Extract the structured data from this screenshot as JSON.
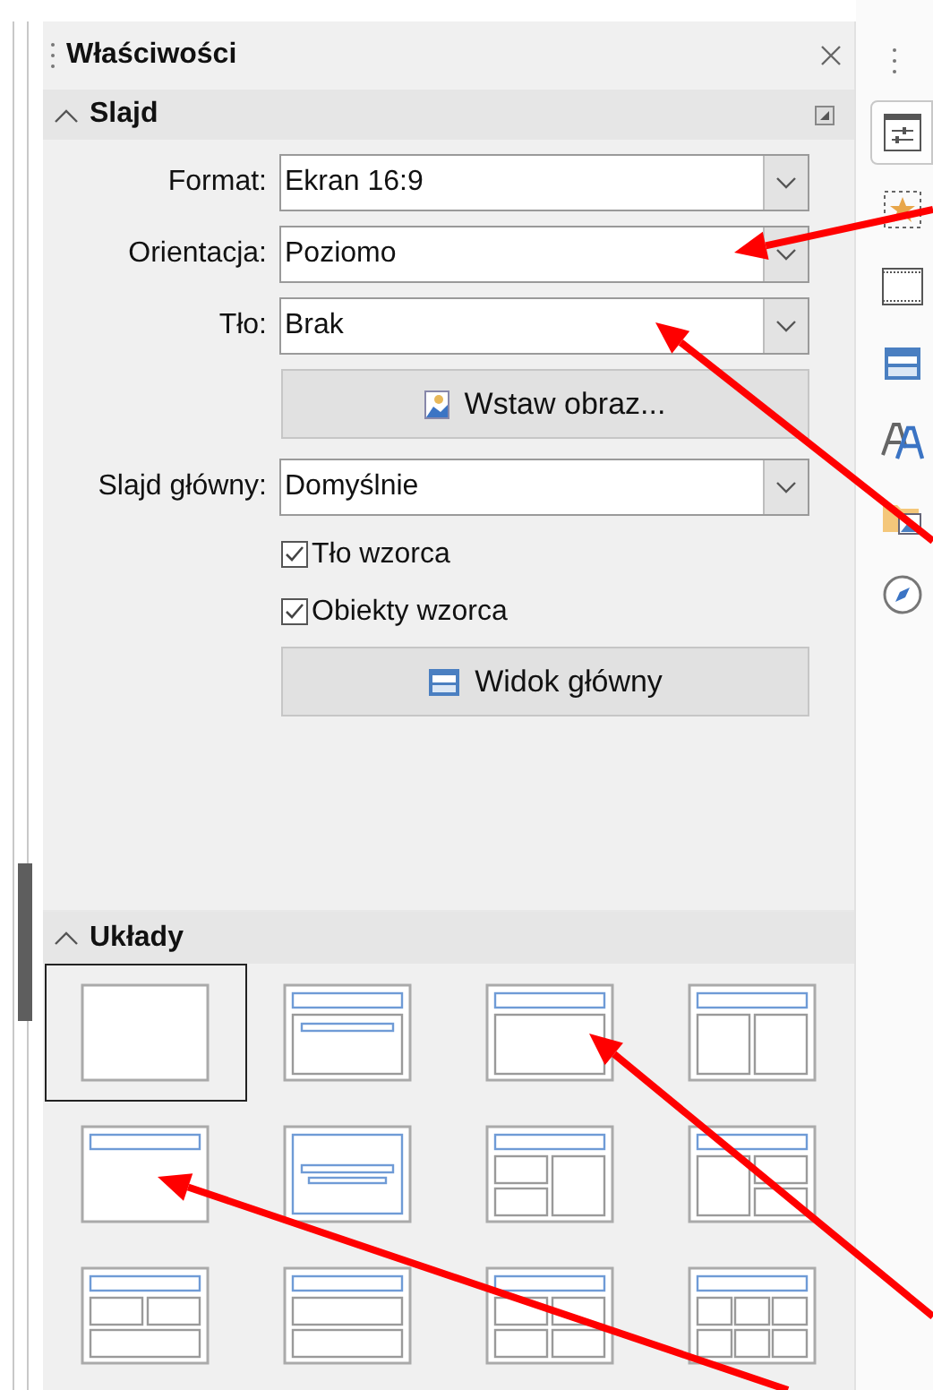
{
  "panel": {
    "title": "Właściwości"
  },
  "slide_section": {
    "title": "Slajd",
    "expanded": true,
    "fields": [
      {
        "label": "Format:",
        "value": "Ekran 16:9"
      },
      {
        "label": "Orientacja:",
        "value": "Poziomo"
      },
      {
        "label": "Tło:",
        "value": "Brak"
      }
    ],
    "insert_image_button": "Wstaw obraz...",
    "master_slide": {
      "label": "Slajd główny:",
      "value": "Domyślnie"
    },
    "checkboxes": [
      {
        "label": "Tło wzorca",
        "checked": true
      },
      {
        "label": "Obiekty wzorca",
        "checked": true
      }
    ],
    "master_view_button": "Widok główny"
  },
  "layouts_section": {
    "title": "Układy",
    "expanded": true,
    "layouts": [
      {
        "kind": "blank",
        "selected": true
      },
      {
        "kind": "title-subtitle",
        "selected": false
      },
      {
        "kind": "title-content",
        "selected": false
      },
      {
        "kind": "title-2content",
        "selected": false
      },
      {
        "kind": "title-only",
        "selected": false
      },
      {
        "kind": "centered-text",
        "selected": false
      },
      {
        "kind": "title-2left-1right",
        "selected": false
      },
      {
        "kind": "title-1left-2right",
        "selected": false
      },
      {
        "kind": "title-2top-1bottom",
        "selected": false
      },
      {
        "kind": "title-1top-1bottom",
        "selected": false
      },
      {
        "kind": "title-4content",
        "selected": false
      },
      {
        "kind": "title-6content",
        "selected": false
      }
    ]
  },
  "sidebar_tabs": [
    {
      "kind": "properties",
      "selected": true
    },
    {
      "kind": "shapes",
      "selected": false
    },
    {
      "kind": "slide-transition",
      "selected": false
    },
    {
      "kind": "master-slides",
      "selected": false
    },
    {
      "kind": "styles",
      "selected": false
    },
    {
      "kind": "gallery",
      "selected": false
    },
    {
      "kind": "navigator",
      "selected": false
    }
  ]
}
